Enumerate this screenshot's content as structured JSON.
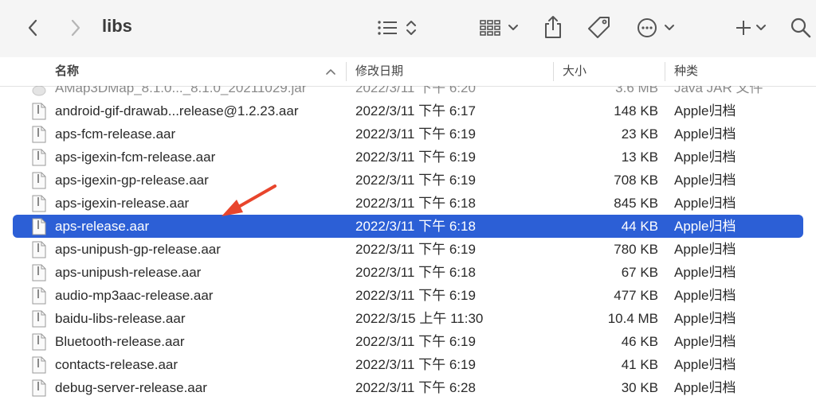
{
  "toolbar": {
    "title": "libs",
    "icons": [
      "chevron-left-icon",
      "chevron-right-icon",
      "list-view-icon",
      "grid-view-icon",
      "share-icon",
      "tag-icon",
      "more-icon",
      "add-icon",
      "search-icon"
    ]
  },
  "columns": {
    "name": "名称",
    "date": "修改日期",
    "size": "大小",
    "kind": "种类"
  },
  "files": [
    {
      "name": "AMap3DMap_8.1.0..._8.1.0_20211029.jar",
      "date": "2022/3/11 下午 6:20",
      "size": "3.6 MB",
      "kind": "Java JAR 文件",
      "partial": true
    },
    {
      "name": "android-gif-drawab...release@1.2.23.aar",
      "date": "2022/3/11 下午 6:17",
      "size": "148 KB",
      "kind": "Apple归档"
    },
    {
      "name": "aps-fcm-release.aar",
      "date": "2022/3/11 下午 6:19",
      "size": "23 KB",
      "kind": "Apple归档"
    },
    {
      "name": "aps-igexin-fcm-release.aar",
      "date": "2022/3/11 下午 6:19",
      "size": "13 KB",
      "kind": "Apple归档"
    },
    {
      "name": "aps-igexin-gp-release.aar",
      "date": "2022/3/11 下午 6:19",
      "size": "708 KB",
      "kind": "Apple归档"
    },
    {
      "name": "aps-igexin-release.aar",
      "date": "2022/3/11 下午 6:18",
      "size": "845 KB",
      "kind": "Apple归档"
    },
    {
      "name": "aps-release.aar",
      "date": "2022/3/11 下午 6:18",
      "size": "44 KB",
      "kind": "Apple归档",
      "selected": true
    },
    {
      "name": "aps-unipush-gp-release.aar",
      "date": "2022/3/11 下午 6:19",
      "size": "780 KB",
      "kind": "Apple归档"
    },
    {
      "name": "aps-unipush-release.aar",
      "date": "2022/3/11 下午 6:18",
      "size": "67 KB",
      "kind": "Apple归档"
    },
    {
      "name": "audio-mp3aac-release.aar",
      "date": "2022/3/11 下午 6:19",
      "size": "477 KB",
      "kind": "Apple归档"
    },
    {
      "name": "baidu-libs-release.aar",
      "date": "2022/3/15 上午 11:30",
      "size": "10.4 MB",
      "kind": "Apple归档"
    },
    {
      "name": "Bluetooth-release.aar",
      "date": "2022/3/11 下午 6:19",
      "size": "46 KB",
      "kind": "Apple归档"
    },
    {
      "name": "contacts-release.aar",
      "date": "2022/3/11 下午 6:19",
      "size": "41 KB",
      "kind": "Apple归档"
    },
    {
      "name": "debug-server-release.aar",
      "date": "2022/3/11 下午 6:28",
      "size": "30 KB",
      "kind": "Apple归档"
    }
  ],
  "colors": {
    "selection": "#2c5fd6",
    "annotation_arrow": "#e8452c",
    "toolbar_bg": "#f5f5f5"
  }
}
